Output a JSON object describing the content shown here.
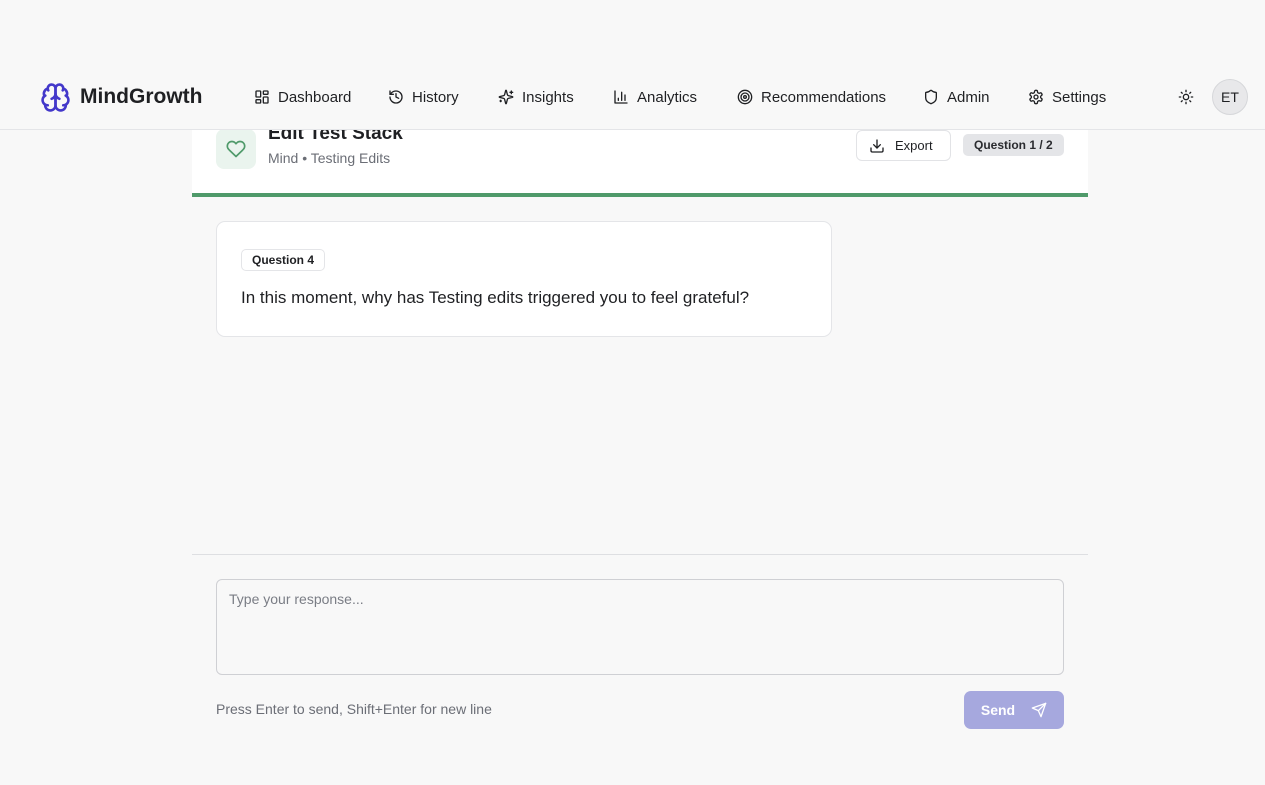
{
  "app": {
    "name": "MindGrowth",
    "accent": "#4338ca"
  },
  "nav": {
    "items": [
      {
        "label": "Dashboard",
        "icon": "dashboard-icon"
      },
      {
        "label": "History",
        "icon": "history-icon"
      },
      {
        "label": "Insights",
        "icon": "sparkles-icon"
      },
      {
        "label": "Analytics",
        "icon": "bar-chart-icon"
      },
      {
        "label": "Recommendations",
        "icon": "target-icon"
      },
      {
        "label": "Admin",
        "icon": "shield-icon"
      },
      {
        "label": "Settings",
        "icon": "gear-icon"
      }
    ],
    "theme_icon": "sun-icon",
    "avatar_initials": "ET"
  },
  "session": {
    "title": "Edit Test Stack",
    "subtitle": "Mind • Testing Edits",
    "export_label": "Export",
    "progress_label": "Question 1 / 2",
    "progress_color": "#4f9a6a",
    "icon": "heart-icon"
  },
  "question": {
    "tag": "Question 4",
    "text": "In this moment, why has Testing edits triggered you to feel grateful?"
  },
  "composer": {
    "placeholder": "Type your response...",
    "value": "",
    "hint": "Press Enter to send, Shift+Enter for new line",
    "send_label": "Send",
    "send_color": "#a6a8de"
  }
}
